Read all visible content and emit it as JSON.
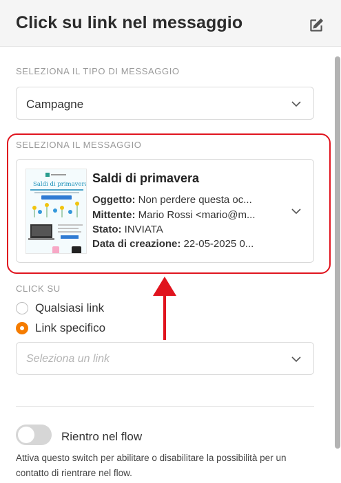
{
  "header": {
    "title": "Click su link nel messaggio",
    "edit_icon": "edit-icon"
  },
  "message_type": {
    "label": "SELEZIONA IL TIPO DI MESSAGGIO",
    "value": "Campagne"
  },
  "message_select": {
    "label": "SELEZIONA IL MESSAGGIO",
    "card": {
      "title": "Saldi di primavera",
      "subject_key": "Oggetto:",
      "subject_value": " Non perdere questa oc...",
      "sender_key": "Mittente:",
      "sender_value": " Mario Rossi <mario@m...",
      "status_key": "Stato:",
      "status_value": " INVIATA",
      "created_key": "Data di creazione:",
      "created_value": " 22-05-2025 0..."
    }
  },
  "click_on": {
    "label": "CLICK SU",
    "options": [
      {
        "label": "Qualsiasi link",
        "selected": false
      },
      {
        "label": "Link specifico",
        "selected": true
      }
    ],
    "link_placeholder": "Seleziona un link"
  },
  "reentry": {
    "label": "Rientro nel flow",
    "enabled": false,
    "help": "Attiva questo switch per abilitare o disabilitare la possibilità per un contatto di rientrare nel flow."
  },
  "colors": {
    "highlight": "#e0141e",
    "accent": "#f57c00"
  }
}
